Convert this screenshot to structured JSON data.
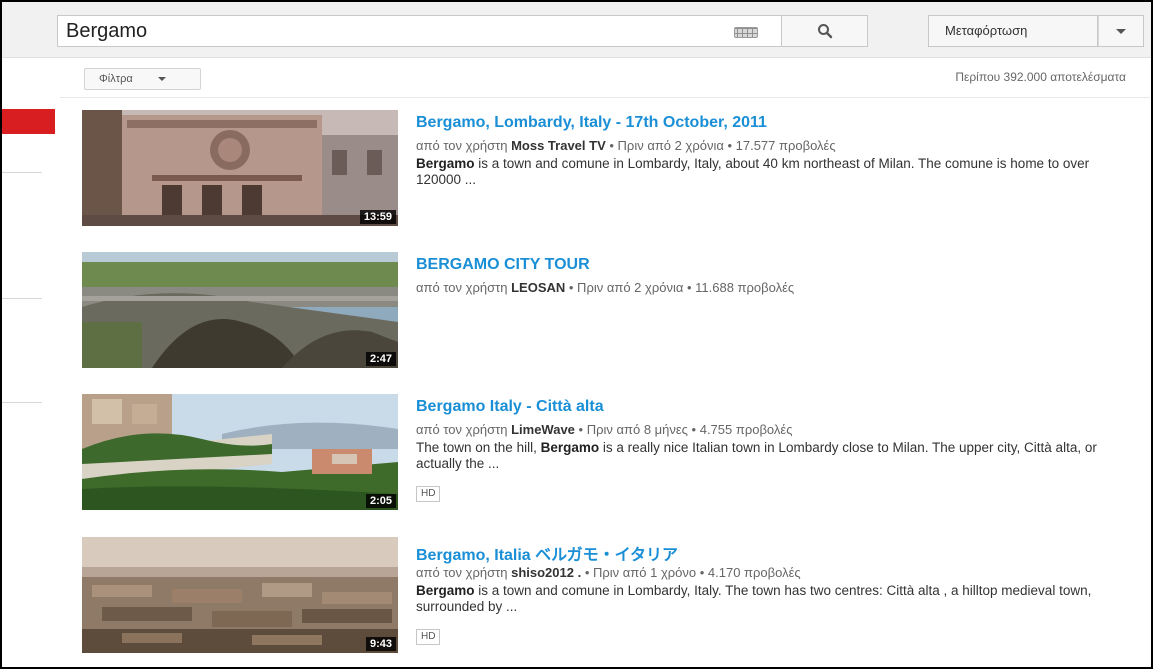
{
  "header": {
    "search_value": "Bergamo",
    "upload_label": "Μεταφόρτωση",
    "icons": {
      "search": "search-icon",
      "keyboard": "keyboard-icon",
      "dropdown": "chevron-down-icon"
    }
  },
  "filters": {
    "label": "Φίλτρα",
    "result_count": "Περίπου 392.000 αποτελέσματα"
  },
  "results": [
    {
      "title": "Bergamo, Lombardy, Italy - 17th October, 2011",
      "meta_prefix": "από τον χρήστη",
      "author": "Moss Travel TV",
      "meta_suffix": "• Πριν από 2 χρόνια • 17.577 προβολές",
      "desc_bold": "Bergamo",
      "desc_rest": " is a town and comune in Lombardy, Italy, about 40 km northeast of Milan. The comune is home to over 120000 ...",
      "duration": "13:59",
      "badge": ""
    },
    {
      "title": "BERGAMO CITY TOUR",
      "meta_prefix": "από τον χρήστη",
      "author": "LEOSAN",
      "meta_suffix": "• Πριν από 2 χρόνια • 11.688 προβολές",
      "desc_bold": "",
      "desc_rest": "",
      "duration": "2:47",
      "badge": ""
    },
    {
      "title": "Bergamo Italy - Città alta",
      "meta_prefix": "από τον χρήστη",
      "author": "LimeWave",
      "meta_suffix": "• Πριν από 8 μήνες • 4.755 προβολές",
      "desc_pre": "The town on the hill, ",
      "desc_bold": "Bergamo",
      "desc_rest": " is a really nice Italian town in Lombardy close to Milan. The upper city, Città alta, or actually the ...",
      "duration": "2:05",
      "badge": "HD"
    },
    {
      "title": "Bergamo, Italia ベルガモ・イタリア",
      "meta_prefix": "από τον χρήστη",
      "author": "shiso2012 .",
      "meta_suffix": "• Πριν από 1 χρόνο • 4.170 προβολές",
      "desc_bold": "Bergamo",
      "desc_rest": " is a town and comune in Lombardy, Italy. The town has two centres: Città alta , a hilltop medieval town, surrounded by ...",
      "duration": "9:43",
      "badge": "HD"
    }
  ]
}
